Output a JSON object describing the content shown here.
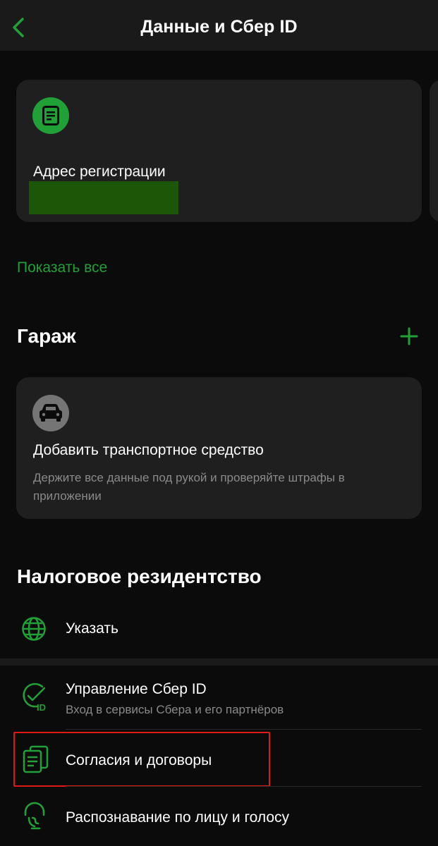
{
  "header": {
    "title": "Данные и Сбер ID"
  },
  "documents": {
    "card_label": "Адрес регистрации",
    "show_all": "Показать все"
  },
  "garage": {
    "title": "Гараж",
    "add_title": "Добавить транспортное средство",
    "add_description": "Держите все данные под рукой и проверяйте штрафы в приложении"
  },
  "tax": {
    "title": "Налоговое резидентство",
    "action_label": "Указать"
  },
  "menu": {
    "items": [
      {
        "label": "Управление Сбер ID",
        "sublabel": "Вход в сервисы Сбера и его партнёров",
        "icon": "sber-id-check-icon"
      },
      {
        "label": "Согласия и договоры",
        "icon": "documents-icon"
      },
      {
        "label": "Распознавание по лицу и голосу",
        "icon": "face-voice-icon"
      }
    ]
  },
  "colors": {
    "accent": "#21a038",
    "background": "#0b0b0b",
    "card": "#1f1f1f",
    "highlight": "#e01818"
  }
}
